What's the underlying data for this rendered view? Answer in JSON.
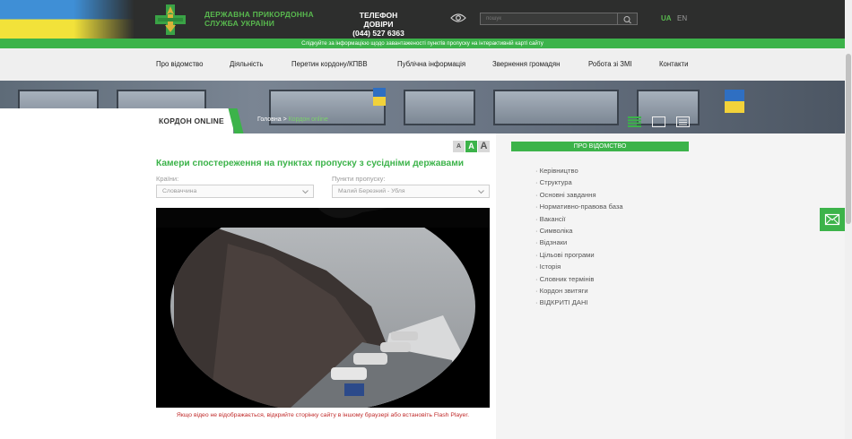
{
  "header": {
    "org_name": "ДЕРЖАВНА ПРИКОРДОННА СЛУЖБА УКРАЇНИ",
    "hotline_title": "ТЕЛЕФОН ДОВІРИ",
    "hotline_number": "(044) 527 6363",
    "search_placeholder": "пошук",
    "lang_ua": "UA",
    "lang_en": "EN"
  },
  "notice": "Слідкуйте за інформацією щодо завантаженості пунктів пропуску на інтерактивній карті сайту",
  "nav": {
    "items": [
      {
        "label": "Про відомство"
      },
      {
        "label": "Діяльність"
      },
      {
        "label": "Перетин кордону/КПВВ"
      },
      {
        "label": "Публічна інформація"
      },
      {
        "label": "Звернення громадян"
      },
      {
        "label": "Робота зі ЗМІ"
      },
      {
        "label": "Контакти"
      }
    ]
  },
  "section": {
    "title": "КОРДОН ONLINE",
    "breadcrumb_home": "Головна",
    "breadcrumb_sep": ">",
    "breadcrumb_current": "Кордон online"
  },
  "font_size": {
    "small": "A",
    "medium": "A",
    "large": "A"
  },
  "page": {
    "title": "Камери спостереження на пунктах пропуску з сусідніми державами",
    "country_label": "Країни:",
    "country_value": "Словаччина",
    "checkpoint_label": "Пункти пропуску:",
    "checkpoint_value": "Малий Березний - Убля",
    "video_note": "Якщо відео не відображається, відкрийте сторінку сайту в іншому браузері або встановіть Flash Player."
  },
  "sidebar": {
    "title": "ПРО ВІДОМСТВО",
    "items": [
      {
        "label": "Керівництво"
      },
      {
        "label": "Структура"
      },
      {
        "label": "Основні завдання"
      },
      {
        "label": "Нормативно-правова база"
      },
      {
        "label": "Вакансії"
      },
      {
        "label": "Символіка"
      },
      {
        "label": "Відзнаки"
      },
      {
        "label": "Цільові програми"
      },
      {
        "label": "Історія"
      },
      {
        "label": "Словник термінів"
      },
      {
        "label": "Кордон звитяги"
      },
      {
        "label": "ВІДКРИТІ ДАНІ"
      }
    ]
  },
  "colors": {
    "accent": "#3cb34a",
    "header_bg": "#2d2e2d",
    "alert_text": "#c02a2a"
  }
}
